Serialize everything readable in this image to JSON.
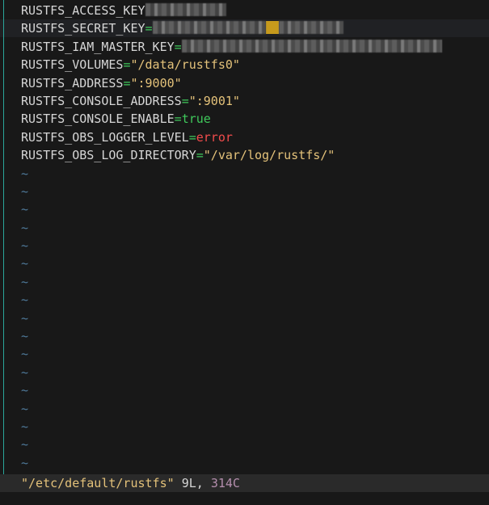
{
  "editor": {
    "lines": [
      {
        "key": "RUSTFS_ACCESS_KEY",
        "eq": "",
        "value": "",
        "kind": "redacted"
      },
      {
        "key": "RUSTFS_SECRET_KEY",
        "eq": "=",
        "value": "",
        "kind": "redacted-yellow"
      },
      {
        "key": "RUSTFS_IAM_MASTER_KEY",
        "eq": "=",
        "value": "",
        "kind": "redacted"
      },
      {
        "key": "RUSTFS_VOLUMES",
        "eq": "=",
        "value": "\"/data/rustfs0\"",
        "kind": "string"
      },
      {
        "key": "RUSTFS_ADDRESS",
        "eq": "=",
        "value": "\":9000\"",
        "kind": "string"
      },
      {
        "key": "RUSTFS_CONSOLE_ADDRESS",
        "eq": "=",
        "value": "\":9001\"",
        "kind": "string"
      },
      {
        "key": "RUSTFS_CONSOLE_ENABLE",
        "eq": "=",
        "value": "true",
        "kind": "true"
      },
      {
        "key": "RUSTFS_OBS_LOGGER_LEVEL",
        "eq": "=",
        "value": "error",
        "kind": "error"
      },
      {
        "key": "RUSTFS_OBS_LOG_DIRECTORY",
        "eq": "=",
        "value": "\"/var/log/rustfs/\"",
        "kind": "string"
      }
    ],
    "tilde": "~",
    "tilde_count": 17
  },
  "status_bar": {
    "file": "\"/etc/default/rustfs\"",
    "lines": "9L,",
    "chars": "314C"
  },
  "colors": {
    "background": "#181818",
    "key": "#d6d6d6",
    "equals": "#3fc85b",
    "string": "#e4c27a",
    "true": "#3fc85b",
    "error": "#f14c4c",
    "tilde": "#4f7a9b",
    "gutter": "#2aa59a"
  }
}
